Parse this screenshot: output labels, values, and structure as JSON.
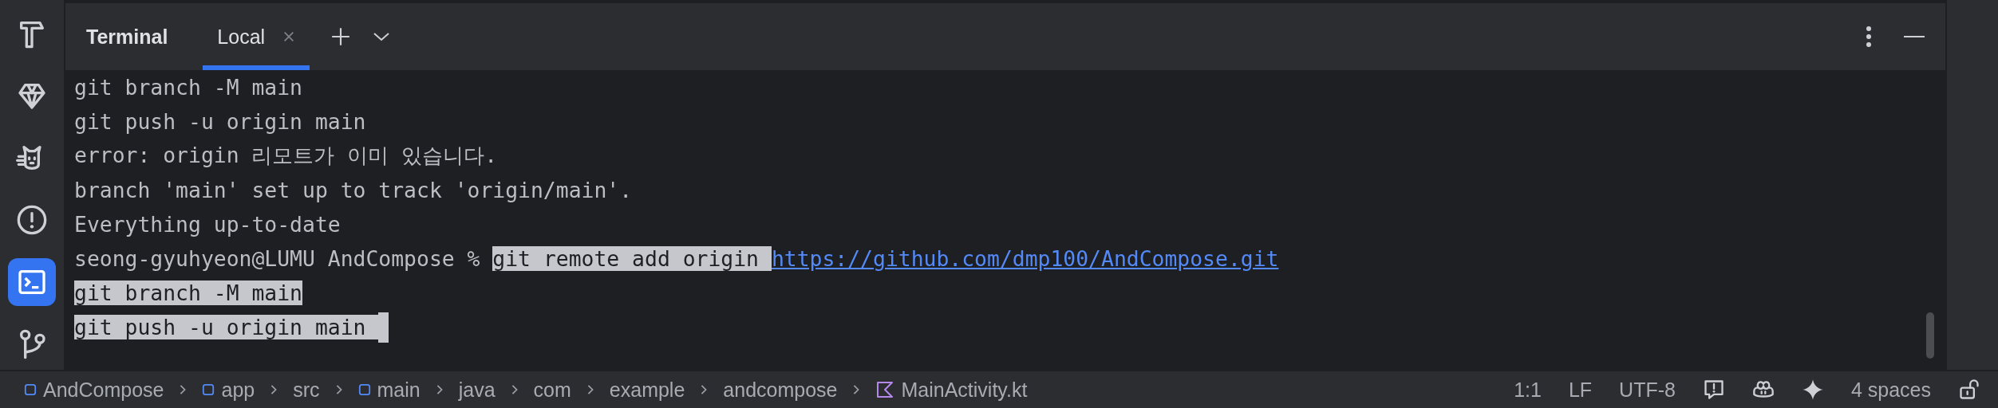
{
  "sidebar": {
    "items": [
      {
        "kind": "hammer",
        "selected": false
      },
      {
        "kind": "gem",
        "selected": false
      },
      {
        "kind": "cat",
        "selected": false
      },
      {
        "kind": "alert",
        "selected": false
      },
      {
        "kind": "terminal",
        "selected": true
      },
      {
        "kind": "branch",
        "selected": false
      }
    ]
  },
  "tool_window": {
    "title": "Terminal",
    "tabs": [
      {
        "label": "Local",
        "selected": true,
        "closable": true
      }
    ]
  },
  "terminal": {
    "lines": [
      {
        "segments": [
          {
            "kind": "text",
            "text": "git branch -M main",
            "selected": false
          }
        ]
      },
      {
        "segments": [
          {
            "kind": "text",
            "text": "git push -u origin main",
            "selected": false
          }
        ]
      },
      {
        "segments": [
          {
            "kind": "text",
            "text": "error: origin 리모트가 이미 있습니다.",
            "selected": false
          }
        ]
      },
      {
        "segments": [
          {
            "kind": "text",
            "text": "branch 'main' set up to track 'origin/main'.",
            "selected": false
          }
        ]
      },
      {
        "segments": [
          {
            "kind": "text",
            "text": "Everything up-to-date",
            "selected": false
          }
        ]
      },
      {
        "segments": [
          {
            "kind": "text",
            "text": "seong-gyuhyeon@LUMU AndCompose % ",
            "selected": false
          },
          {
            "kind": "text",
            "text": "git remote add origin ",
            "selected": true
          },
          {
            "kind": "link",
            "text": "https://github.com/dmp100/AndCompose.git",
            "selected": false
          }
        ]
      },
      {
        "segments": [
          {
            "kind": "text",
            "text": "git branch -M main",
            "selected": true
          }
        ]
      },
      {
        "segments": [
          {
            "kind": "text",
            "text": "git push -u origin main ",
            "selected": true
          }
        ],
        "cursor": true
      }
    ]
  },
  "status_bar": {
    "breadcrumbs": [
      {
        "kind": "module",
        "label": "AndCompose"
      },
      {
        "kind": "module",
        "label": "app"
      },
      {
        "kind": "folder",
        "label": "src"
      },
      {
        "kind": "module",
        "label": "main"
      },
      {
        "kind": "folder",
        "label": "java"
      },
      {
        "kind": "folder",
        "label": "com"
      },
      {
        "kind": "folder",
        "label": "example"
      },
      {
        "kind": "folder",
        "label": "andcompose"
      },
      {
        "kind": "kotlin-file",
        "label": "MainActivity.kt"
      }
    ],
    "widgets": [
      {
        "kind": "text",
        "text": "1:1"
      },
      {
        "kind": "text",
        "text": "LF"
      },
      {
        "kind": "text",
        "text": "UTF-8"
      },
      {
        "kind": "comment-alert"
      },
      {
        "kind": "copilot"
      },
      {
        "kind": "sparkle"
      },
      {
        "kind": "text",
        "text": "4 spaces"
      },
      {
        "kind": "lock"
      }
    ]
  }
}
